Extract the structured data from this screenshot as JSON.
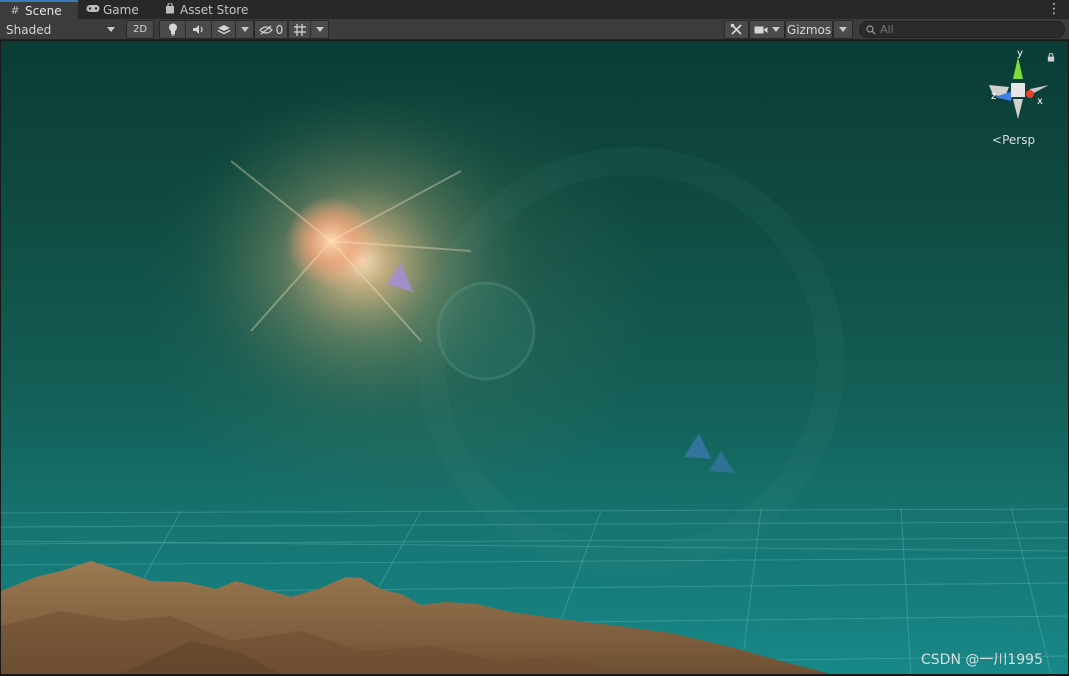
{
  "tabs": [
    {
      "label": "Scene",
      "icon": "grid-icon",
      "active": true
    },
    {
      "label": "Game",
      "icon": "gamepad-icon",
      "active": false
    },
    {
      "label": "Asset Store",
      "icon": "shopping-bag-icon",
      "active": false
    }
  ],
  "toolbar": {
    "draw_mode": "Shaded",
    "mode_2d": "2D",
    "hidden_count": "0",
    "gizmos_label": "Gizmos",
    "search_placeholder": "All"
  },
  "scene": {
    "view_label": "Persp",
    "axes": {
      "y": "y",
      "x": "x",
      "z": "z"
    }
  },
  "watermark": "CSDN @一川1995",
  "colors": {
    "accent": "#3a79bb",
    "toolbar": "#3c3c3c",
    "sky_top": "#0a3c35",
    "sky_horizon": "#167572",
    "terrain": "#8c6a45",
    "axis_x": "#e8402f",
    "axis_y": "#7ddc3c",
    "axis_z": "#3f7de8"
  }
}
